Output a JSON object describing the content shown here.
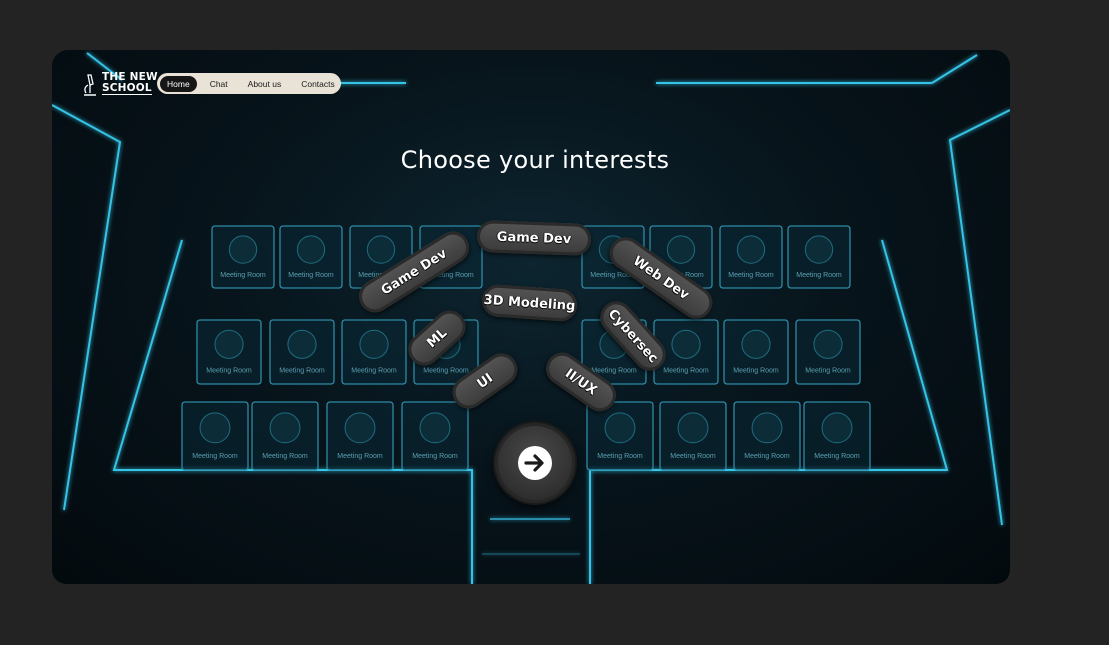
{
  "brand": {
    "line1": "THE NEW",
    "line2": "SCHOOL"
  },
  "nav": {
    "items": [
      "Home",
      "Chat",
      "About us",
      "Contacts"
    ],
    "active": "Home"
  },
  "heading": "Choose your interests",
  "interests": [
    "Game Dev",
    "Game Dev",
    "Web Dev",
    "3D Modeling",
    "ML",
    "Cybersec",
    "UI",
    "II/UX"
  ],
  "room_label": "Meeting Room",
  "next_icon": "arrow-right-circle-icon",
  "colors": {
    "neon": "#35c3e6",
    "chip": "#444444",
    "nav_bg": "#e9e2d7"
  }
}
